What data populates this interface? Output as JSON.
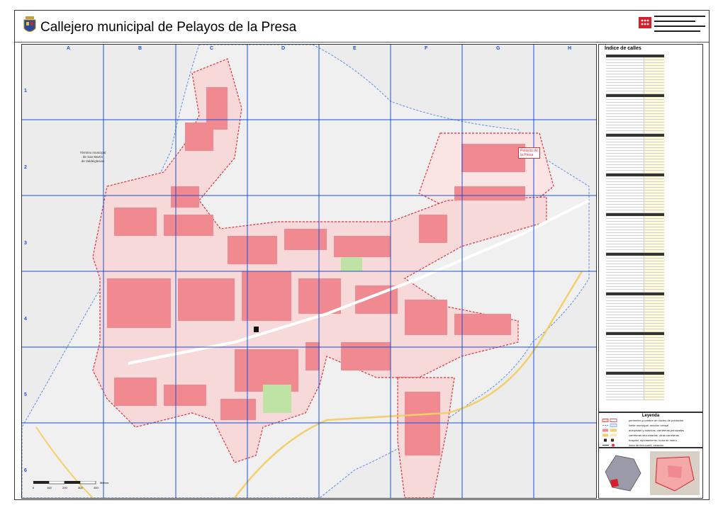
{
  "title": "Callejero municipal de Pelayos de la Presa",
  "grid": {
    "columns": [
      "A",
      "B",
      "C",
      "D",
      "E",
      "F",
      "G",
      "H"
    ],
    "rows": [
      "1",
      "2",
      "3",
      "4",
      "5",
      "6"
    ]
  },
  "map_labels": {
    "neighbour_line1": "Término municipal",
    "neighbour_line2": "de San Martín",
    "neighbour_line3": "de Valdeiglesias",
    "locality_line1": "Pelayos de",
    "locality_line2": "la Presa"
  },
  "index": {
    "title": "Índice de calles"
  },
  "legend": {
    "title": "Leyenda",
    "items": [
      "perímetro y nombre de núcleo de población",
      "límite municipal; sección censal",
      "autopistas y autovías; carreteras principales",
      "carreteras secundarias; otras carreteras",
      "hospital; ayuntamiento; boca de metro",
      "línea de ferrocarril; estación"
    ]
  },
  "scale": {
    "ticks": [
      "0",
      "100",
      "200",
      "300",
      "400"
    ],
    "unit": "Metros"
  },
  "colors": {
    "grid": "#1a4fd6",
    "perimeter": "#e0303a",
    "built": "#f08a90",
    "boundary": "#5b8de0",
    "road": "#f2cf6a"
  }
}
